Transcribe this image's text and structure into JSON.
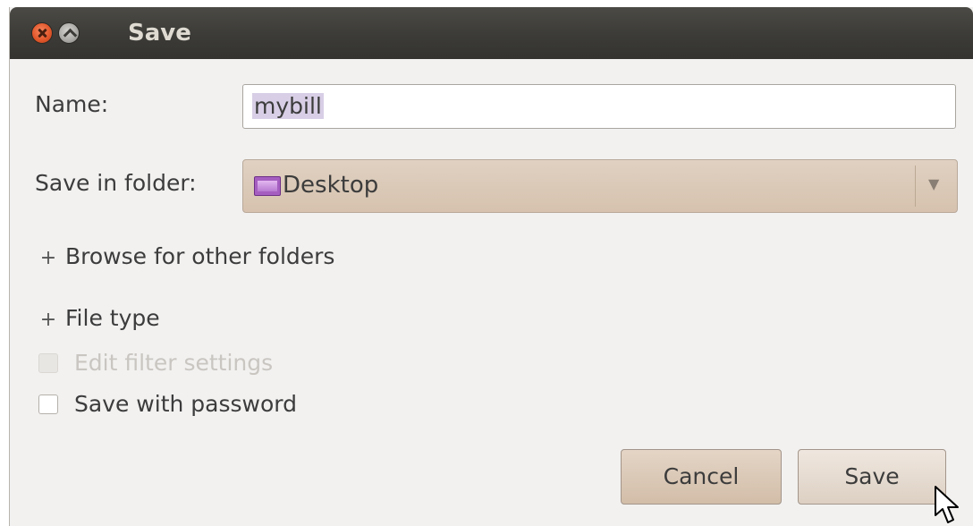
{
  "window": {
    "title": "Save"
  },
  "form": {
    "name_label": "Name:",
    "name_value": "mybill",
    "folder_label": "Save in folder:",
    "folder_value": "Desktop",
    "folder_icon": "desktop-folder-icon"
  },
  "options": {
    "browse_label": "Browse for other folders",
    "filetype_label": "File type",
    "expander_glyph": "+",
    "edit_filter_label": "Edit filter settings",
    "edit_filter_checked": false,
    "edit_filter_enabled": false,
    "save_password_label": "Save with password",
    "save_password_checked": false
  },
  "buttons": {
    "cancel": "Cancel",
    "save": "Save"
  },
  "colors": {
    "titlebar": "#3c3b37",
    "close_button": "#e2582c",
    "dialog_bg": "#f2f1f0",
    "button_bg": "#d6c2ae",
    "name_selection": "#d8cfe6"
  }
}
